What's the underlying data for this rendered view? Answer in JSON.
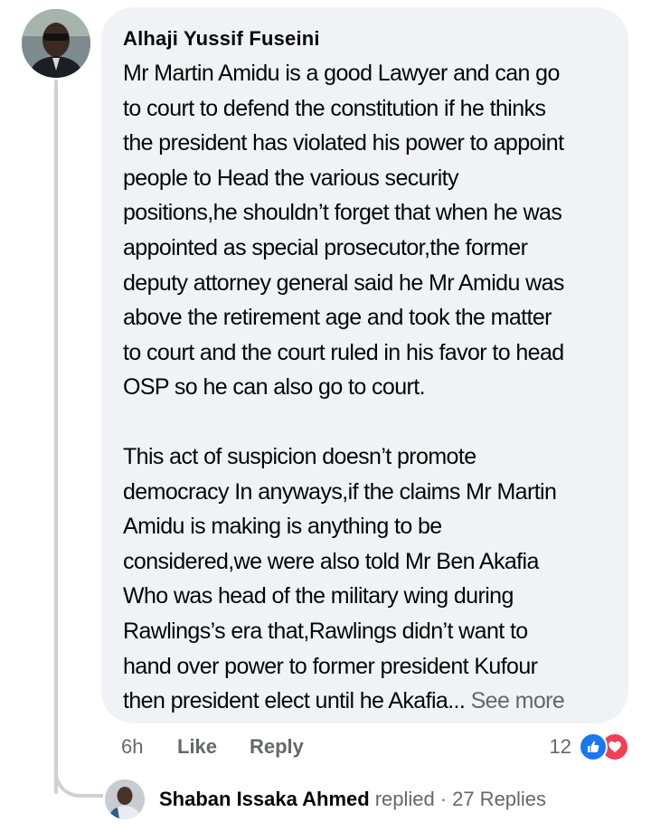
{
  "comment": {
    "author": "Alhaji Yussif Fuseini",
    "paragraph_1": "Mr Martin Amidu is a good Lawyer and can go\nto court to defend the constitution if he thinks\nthe president has violated his power to appoint\npeople to Head the various security\npositions,he shouldn’t forget that when he was\nappointed as special prosecutor,the former\ndeputy attorney general said he Mr Amidu was\nabove the retirement age and took the matter\nto court and the court ruled in his favor to head\nOSP so he can also go to court.",
    "paragraph_2": "This act of suspicion doesn’t promote\ndemocracy In anyways,if the claims Mr Martin\nAmidu is making is anything to be\nconsidered,we were also told Mr Ben Akafia\nWho was head of the military wing during\nRawlings’s era that,Rawlings didn’t want to\nhand over power to former president Kufour\nthen president elect until he Akafia... ",
    "see_more": "See more",
    "time": "6h",
    "like_label": "Like",
    "reply_label": "Reply",
    "reaction_count": "12",
    "reactions": [
      "like-icon",
      "love-icon"
    ]
  },
  "replies": {
    "author": "Shaban Issaka Ahmed",
    "verb": "replied",
    "separator": "·",
    "count_label": "27 Replies"
  },
  "colors": {
    "bubble": "#f0f2f5",
    "meta_text": "#65676b",
    "like_blue": "#1877f2",
    "love_red": "#f33e58",
    "thread_line": "#ced0d4"
  }
}
